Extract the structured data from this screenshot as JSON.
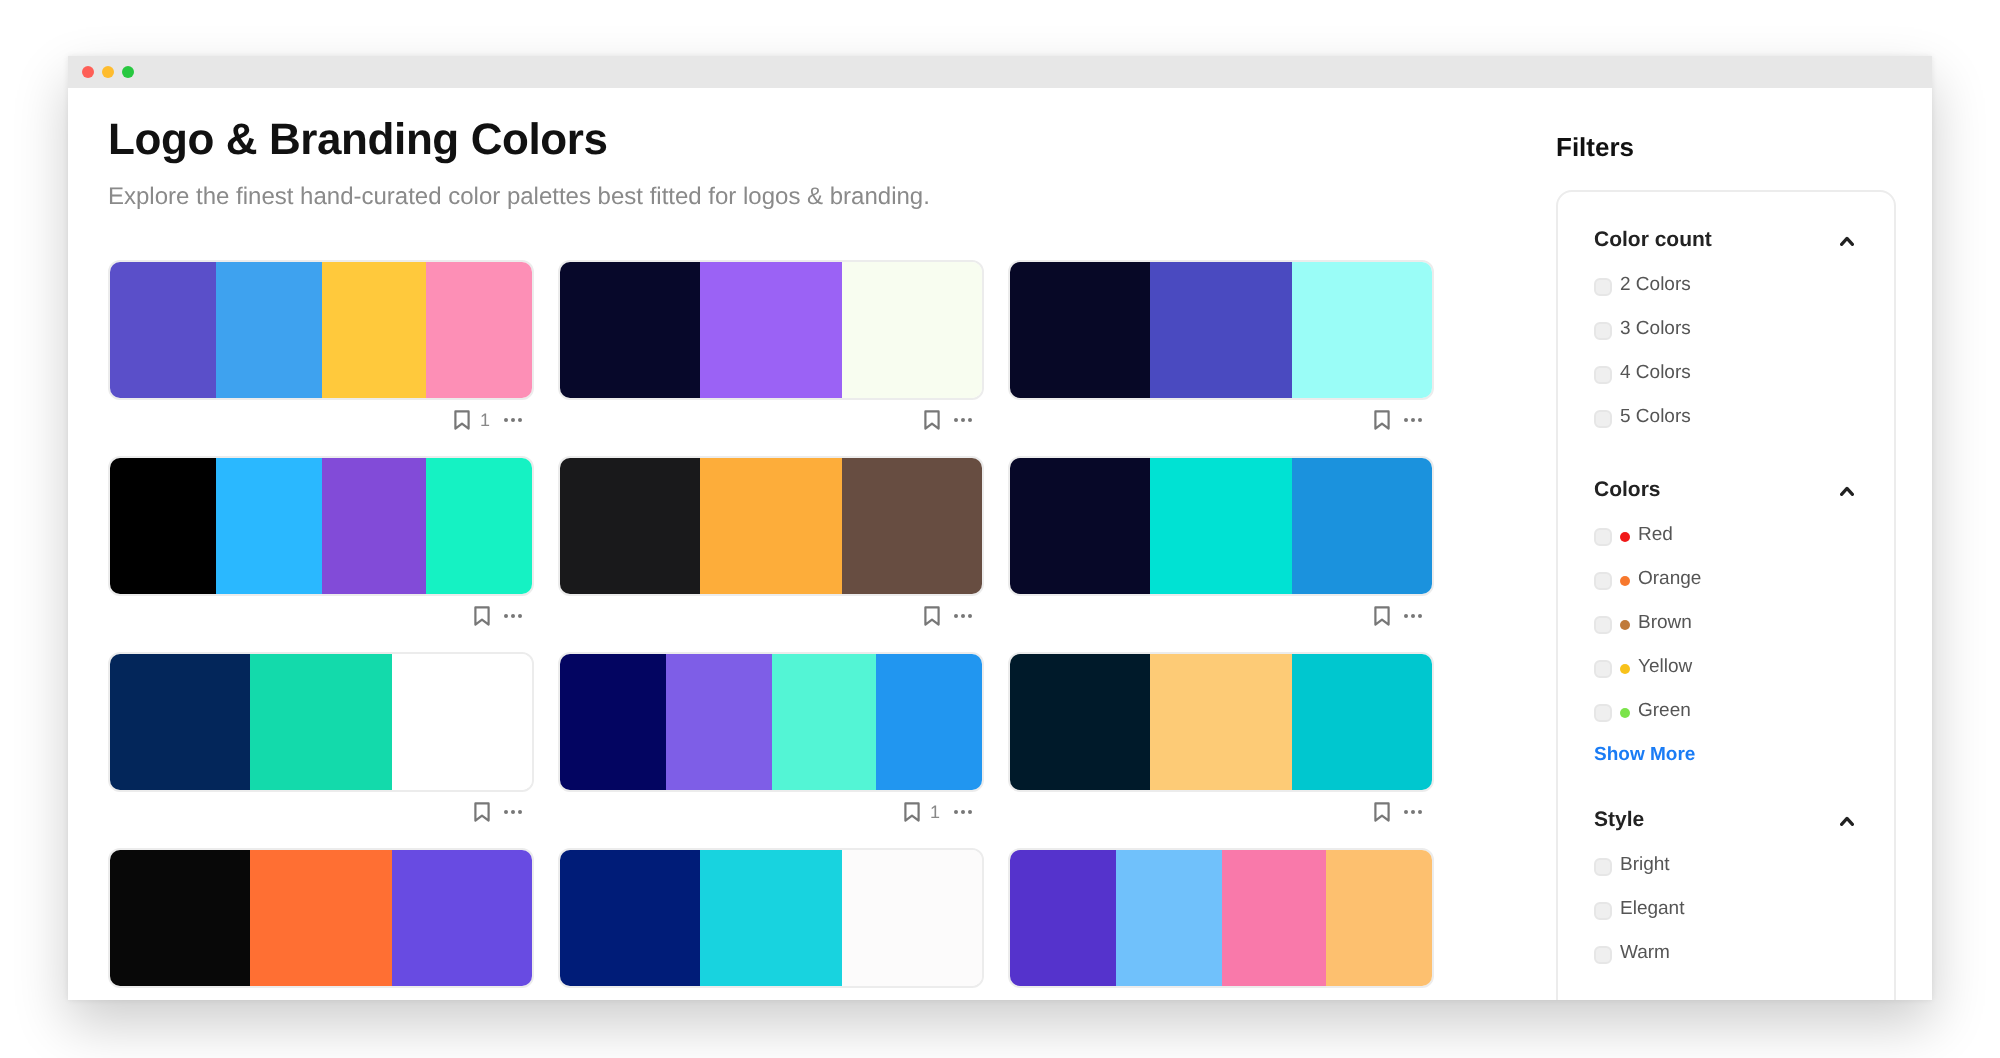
{
  "page": {
    "title": "Logo & Branding Colors",
    "subtitle": "Explore the finest hand-curated color palettes best fitted for logos & branding."
  },
  "palettes": [
    {
      "swatches": [
        {
          "color": "#5a4fc9"
        },
        {
          "color": "#3ea2ef"
        },
        {
          "color": "#ffc93c"
        },
        {
          "color": "#fd8fb6"
        }
      ],
      "footer": {
        "bookmarked": false,
        "saves": "1"
      }
    },
    {
      "swatches": [
        {
          "color": "#07082a"
        },
        {
          "color": "#9b62f5"
        },
        {
          "color": "#f8fdf0"
        }
      ],
      "footer": {
        "bookmarked": false
      }
    },
    {
      "swatches": [
        {
          "color": "#070826"
        },
        {
          "color": "#4a4ac0"
        },
        {
          "color": "#9afdf7"
        }
      ],
      "footer": {
        "bookmarked": false
      }
    },
    {
      "swatches": [
        {
          "color": "#000000"
        },
        {
          "color": "#2ab8ff"
        },
        {
          "color": "#824bd8"
        },
        {
          "color": "#15f2c3"
        }
      ],
      "footer": {
        "bookmarked": false
      }
    },
    {
      "swatches": [
        {
          "color": "#19191b"
        },
        {
          "color": "#fdad3a"
        },
        {
          "color": "#674d41"
        }
      ],
      "footer": {
        "bookmarked": false
      }
    },
    {
      "swatches": [
        {
          "color": "#070828"
        },
        {
          "color": "#00e2d3"
        },
        {
          "color": "#1b92dd"
        }
      ],
      "footer": {
        "bookmarked": false
      }
    },
    {
      "swatches": [
        {
          "color": "#03265a"
        },
        {
          "color": "#13daab"
        },
        {
          "color": "#ffffff"
        }
      ],
      "footer": {
        "bookmarked": false
      }
    },
    {
      "swatches": [
        {
          "color": "#030561"
        },
        {
          "color": "#7e5ee7"
        },
        {
          "color": "#53f5d5"
        },
        {
          "color": "#2196f0"
        }
      ],
      "footer": {
        "bookmarked": false,
        "saves": "1"
      }
    },
    {
      "swatches": [
        {
          "color": "#001a2a"
        },
        {
          "color": "#fdcb76"
        },
        {
          "color": "#00c7cf"
        }
      ],
      "footer": {
        "bookmarked": false
      }
    },
    {
      "swatches": [
        {
          "color": "#080808"
        },
        {
          "color": "#ff6f33"
        },
        {
          "color": "#684be2"
        }
      ]
    },
    {
      "swatches": [
        {
          "color": "#001c78"
        },
        {
          "color": "#18d3df"
        },
        {
          "color": "#fcfbfb"
        }
      ]
    },
    {
      "swatches": [
        {
          "color": "#5533cc"
        },
        {
          "color": "#70c1fb"
        },
        {
          "color": "#f979aa"
        },
        {
          "color": "#fdc06f"
        }
      ]
    }
  ],
  "filters": {
    "title": "Filters",
    "sections": [
      {
        "title": "Color count",
        "expanded": true,
        "options": [
          {
            "label": "2 Colors",
            "checked": false
          },
          {
            "label": "3 Colors",
            "checked": false
          },
          {
            "label": "4 Colors",
            "checked": false
          },
          {
            "label": "5 Colors",
            "checked": false
          }
        ]
      },
      {
        "title": "Colors",
        "expanded": true,
        "options": [
          {
            "label": "Red",
            "checked": false,
            "color": "#f01818"
          },
          {
            "label": "Orange",
            "checked": false,
            "color": "#f7782d"
          },
          {
            "label": "Brown",
            "checked": false,
            "color": "#c07a3a"
          },
          {
            "label": "Yellow",
            "checked": false,
            "color": "#f8c21b"
          },
          {
            "label": "Green",
            "checked": false,
            "color": "#7be34a"
          }
        ],
        "link": "Show More"
      },
      {
        "title": "Style",
        "expanded": true,
        "options": [
          {
            "label": "Bright",
            "checked": false
          },
          {
            "label": "Elegant",
            "checked": false
          },
          {
            "label": "Warm",
            "checked": false
          }
        ]
      }
    ]
  }
}
